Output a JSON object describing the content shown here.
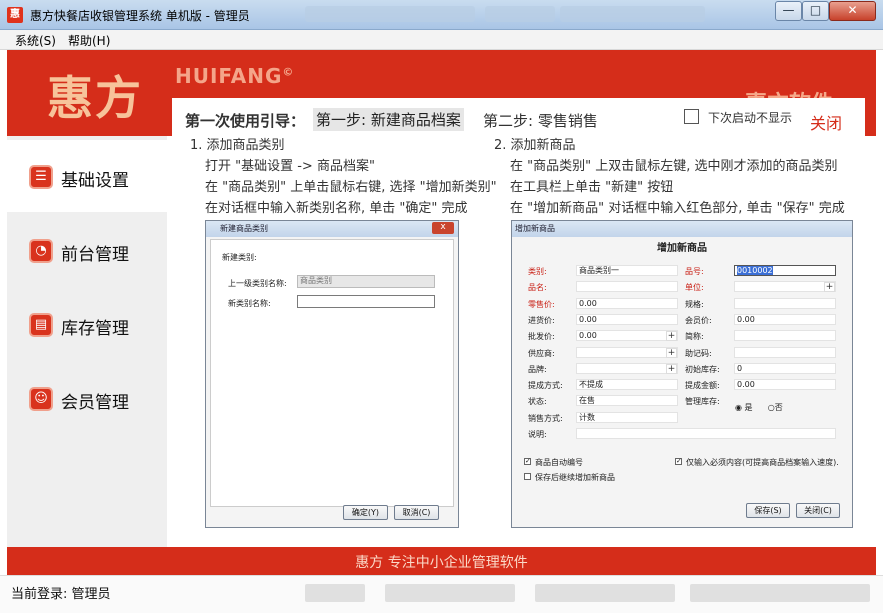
{
  "window": {
    "title": "惠方快餐店收银管理系统 单机版 - 管理员",
    "icon_text": "惠",
    "min": "—",
    "max": "□",
    "close": "✕"
  },
  "menu": {
    "system": "系统(S)",
    "help": "帮助(H)"
  },
  "header": {
    "logo_cn": "惠方",
    "logo_en": "HUIFANG",
    "logo_reg": "©",
    "right_text": "惠方软件"
  },
  "sidebar": {
    "items": [
      {
        "label": "基础设置",
        "icon": "basic-settings-icon"
      },
      {
        "label": "前台管理",
        "icon": "front-desk-icon"
      },
      {
        "label": "库存管理",
        "icon": "inventory-icon"
      },
      {
        "label": "会员管理",
        "icon": "member-icon"
      }
    ]
  },
  "guide": {
    "title": "第一次使用引导：",
    "step1": "第一步: 新建商品档案",
    "step2": "第二步: 零售销售",
    "dont_show": "下次启动不显示",
    "close": "关闭",
    "left": {
      "heading": "1. 添加商品类别",
      "lines": [
        "打开 \"基础设置 -> 商品档案\"",
        "在 \"商品类别\" 上单击鼠标右键, 选择 \"增加新类别\"",
        "在对话框中输入新类别名称, 单击 \"确定\" 完成"
      ]
    },
    "right": {
      "heading": "2. 添加新商品",
      "lines": [
        "在 \"商品类别\" 上双击鼠标左键, 选中刚才添加的商品类别",
        "在工具栏上单击 \"新建\" 按钮",
        "在 \"增加新商品\" 对话框中输入红色部分, 单击 \"保存\" 完成"
      ]
    }
  },
  "dialog_new_category": {
    "title": "新建商品类别",
    "group_label": "新建类别:",
    "parent_label": "上一级类别名称:",
    "parent_value": "商品类别",
    "new_label": "新类别名称:",
    "new_value": "",
    "ok": "确定(Y)",
    "cancel": "取消(C)"
  },
  "dialog_new_product": {
    "title": "增加新商品",
    "heading": "增加新商品",
    "left_fields": [
      {
        "label": "类别:",
        "value": "商品类别一",
        "red": true,
        "plus": false
      },
      {
        "label": "品名:",
        "value": "",
        "red": true,
        "plus": false
      },
      {
        "label": "零售价:",
        "value": "0.00",
        "red": true,
        "plus": false
      },
      {
        "label": "进货价:",
        "value": "0.00",
        "red": false,
        "plus": false
      },
      {
        "label": "批发价:",
        "value": "0.00",
        "red": false,
        "plus": true
      },
      {
        "label": "供应商:",
        "value": "",
        "red": false,
        "plus": true
      },
      {
        "label": "品牌:",
        "value": "",
        "red": false,
        "plus": true
      },
      {
        "label": "提成方式:",
        "value": "不提成",
        "red": false,
        "plus": false
      },
      {
        "label": "状态:",
        "value": "在售",
        "red": false,
        "plus": false
      },
      {
        "label": "销售方式:",
        "value": "计数",
        "red": false,
        "plus": false
      },
      {
        "label": "说明:",
        "value": "",
        "red": false,
        "plus": false
      }
    ],
    "right_fields": [
      {
        "label": "品号:",
        "value": "0010002",
        "red": true,
        "plus": false
      },
      {
        "label": "单位:",
        "value": "",
        "red": true,
        "plus": true
      },
      {
        "label": "规格:",
        "value": "",
        "red": false,
        "plus": false
      },
      {
        "label": "会员价:",
        "value": "0.00",
        "red": false,
        "plus": false
      },
      {
        "label": "简称:",
        "value": "",
        "red": false,
        "plus": false
      },
      {
        "label": "助记码:",
        "value": "",
        "red": false,
        "plus": false
      },
      {
        "label": "初始库存:",
        "value": "0",
        "red": false,
        "plus": false
      },
      {
        "label": "提成金额:",
        "value": "0.00",
        "red": false,
        "plus": false
      },
      {
        "label": "管理库存:",
        "value": "",
        "red": false,
        "plus": false
      }
    ],
    "stock_yes": "是",
    "stock_no": "否",
    "chk_auto_code": "商品自动编号",
    "chk_continue": "保存后继续增加新商品",
    "chk_required_only": "仅输入必须内容(可提高商品档案输入速度).",
    "save": "保存(S)",
    "close": "关闭(C)"
  },
  "footer": {
    "slogan": "惠方  专注中小企业管理软件"
  },
  "status": {
    "login": "当前登录: 管理员"
  }
}
